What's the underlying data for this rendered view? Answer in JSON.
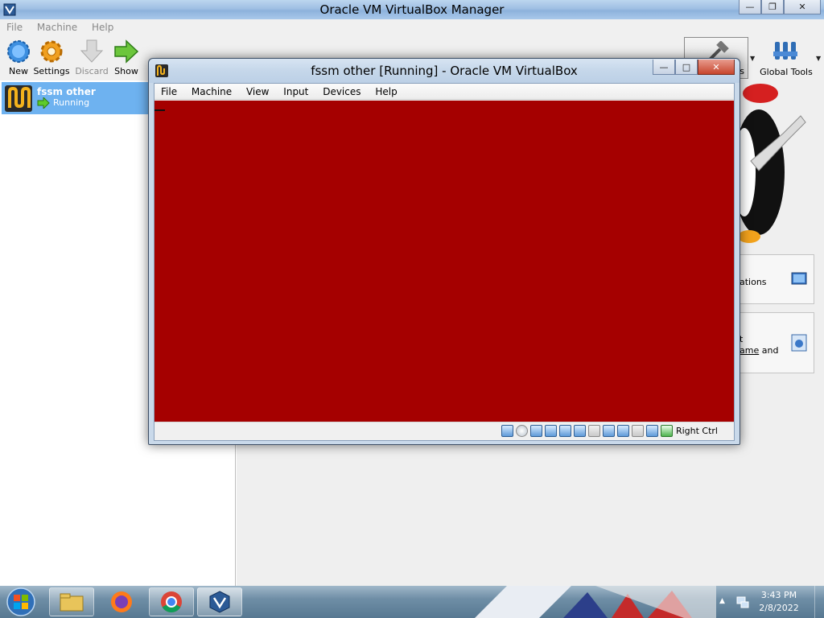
{
  "manager": {
    "title": "Oracle VM VirtualBox Manager",
    "menu": [
      "File",
      "Machine",
      "Help"
    ],
    "toolbar": {
      "new": "New",
      "settings": "Settings",
      "discard": "Discard",
      "show": "Show",
      "global_tools": "Global Tools"
    },
    "vm_list": [
      {
        "name": "fssm other",
        "status": "Running"
      }
    ],
    "details_fragments": {
      "tools_label_tail": "s",
      "card1_text": "ations",
      "card2_line1": "t",
      "card2_link": "ame",
      "card2_tail": " and"
    }
  },
  "vm_window": {
    "title": "fssm other [Running] - Oracle VM VirtualBox",
    "menu": [
      "File",
      "Machine",
      "View",
      "Input",
      "Devices",
      "Help"
    ],
    "screen_color": "#a50000",
    "status_icons": [
      "hard-disk-icon",
      "optical-drive-icon",
      "floppy-icon",
      "audio-icon",
      "network-icon",
      "usb-icon",
      "shared-folder-icon",
      "display-icon",
      "recording-icon",
      "cpu-icon",
      "mouse-integration-icon",
      "keyboard-icon"
    ],
    "host_key": "Right Ctrl"
  },
  "taskbar": {
    "apps": [
      "explorer-icon",
      "firefox-icon",
      "chrome-icon",
      "virtualbox-icon"
    ],
    "clock_time": "3:43 PM",
    "clock_date": "2/8/2022"
  },
  "colors": {
    "selection": "#6eb2f0",
    "vm_screen": "#a50000",
    "taskbar": "#6f8ea6"
  }
}
